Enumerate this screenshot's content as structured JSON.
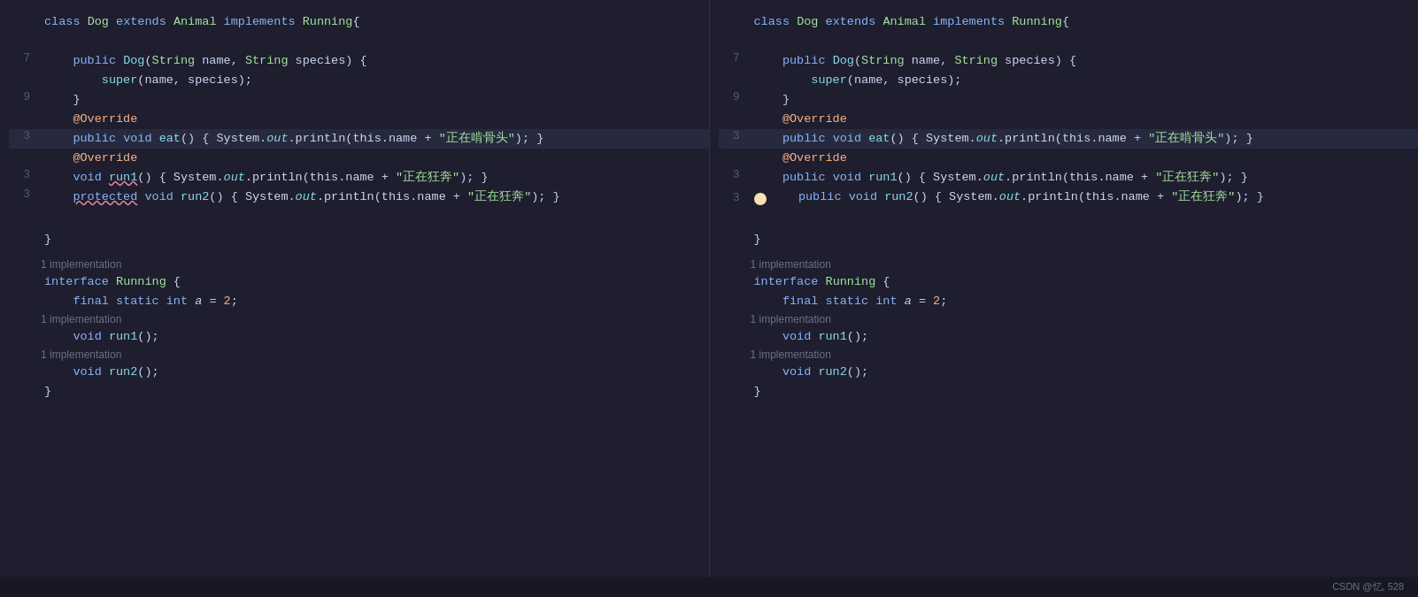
{
  "footer": {
    "credit": "CSDN @忆, 528"
  },
  "panels": [
    {
      "id": "left",
      "sections": [
        {
          "type": "code",
          "lines": [
            {
              "num": "",
              "content": "class Dog extends Animal implements Running{",
              "type": "class-decl"
            },
            {
              "num": "",
              "content": "",
              "type": "empty"
            },
            {
              "num": "7",
              "content": "    public Dog(String name, String species) {",
              "type": "constructor"
            },
            {
              "num": "",
              "content": "        super(name, species);",
              "type": "super"
            },
            {
              "num": "9",
              "content": "    }",
              "type": "brace"
            },
            {
              "num": "",
              "content": "    @Override",
              "type": "annotation"
            },
            {
              "num": "3",
              "content": "    public void eat() { System.out.println(this.name + \"正在啃骨头\"); }",
              "type": "method-line",
              "highlight": true
            },
            {
              "num": "",
              "content": "    @Override",
              "type": "annotation"
            },
            {
              "num": "3",
              "content": "    void run1() { System.out.println(this.name + \"正在狂奔\"); }",
              "type": "method-line2",
              "underline": true
            },
            {
              "num": "3",
              "content": "    protected void run2() { System.out.println(this.name + \"正在狂奔\"); }",
              "type": "method-line3",
              "underline2": true
            }
          ]
        },
        {
          "type": "closing",
          "brace": "}"
        },
        {
          "type": "impl",
          "hint": "1 implementation",
          "lines": [
            {
              "num": "",
              "content": "interface Running {",
              "type": "interface-decl"
            },
            {
              "num": "",
              "content": "    final static int a = 2;",
              "type": "field"
            },
            {
              "num": "",
              "hint": "1 implementation",
              "type": "hint-line"
            },
            {
              "num": "",
              "content": "    void run1();",
              "type": "method-sig"
            },
            {
              "num": "",
              "hint": "1 implementation",
              "type": "hint-line"
            },
            {
              "num": "",
              "content": "    void run2();",
              "type": "method-sig"
            }
          ]
        },
        {
          "type": "closing",
          "brace": "}"
        }
      ]
    },
    {
      "id": "right",
      "sections": [
        {
          "type": "code",
          "lines": [
            {
              "num": "",
              "content": "class Dog extends Animal implements Running{",
              "type": "class-decl"
            },
            {
              "num": "",
              "content": "",
              "type": "empty"
            },
            {
              "num": "7",
              "content": "    public Dog(String name, String species) {",
              "type": "constructor"
            },
            {
              "num": "",
              "content": "        super(name, species);",
              "type": "super"
            },
            {
              "num": "9",
              "content": "    }",
              "type": "brace"
            },
            {
              "num": "",
              "content": "    @Override",
              "type": "annotation"
            },
            {
              "num": "3",
              "content": "    public void eat() { System.out.println(this.name + \"正在啃骨头\"); }",
              "type": "method-line",
              "highlight": true
            },
            {
              "num": "",
              "content": "    @Override",
              "type": "annotation"
            },
            {
              "num": "3",
              "content": "    public void run1() { System.out.println(this.name + \"正在狂奔\"); }",
              "type": "method-line2"
            },
            {
              "num": "3",
              "content": "    public void run2() { System.out.println(this.name + \"正在狂奔\"); }",
              "type": "method-line3",
              "bulb": true
            }
          ]
        },
        {
          "type": "closing",
          "brace": "}"
        },
        {
          "type": "impl",
          "hint": "1 implementation",
          "lines": [
            {
              "num": "",
              "content": "interface Running {",
              "type": "interface-decl"
            },
            {
              "num": "",
              "content": "    final static int a = 2;",
              "type": "field"
            },
            {
              "num": "",
              "hint": "1 implementation",
              "type": "hint-line"
            },
            {
              "num": "",
              "content": "    void run1();",
              "type": "method-sig"
            },
            {
              "num": "",
              "hint": "1 implementation",
              "type": "hint-line"
            },
            {
              "num": "",
              "content": "    void run2();",
              "type": "method-sig"
            }
          ]
        },
        {
          "type": "closing",
          "brace": "}"
        }
      ]
    }
  ]
}
